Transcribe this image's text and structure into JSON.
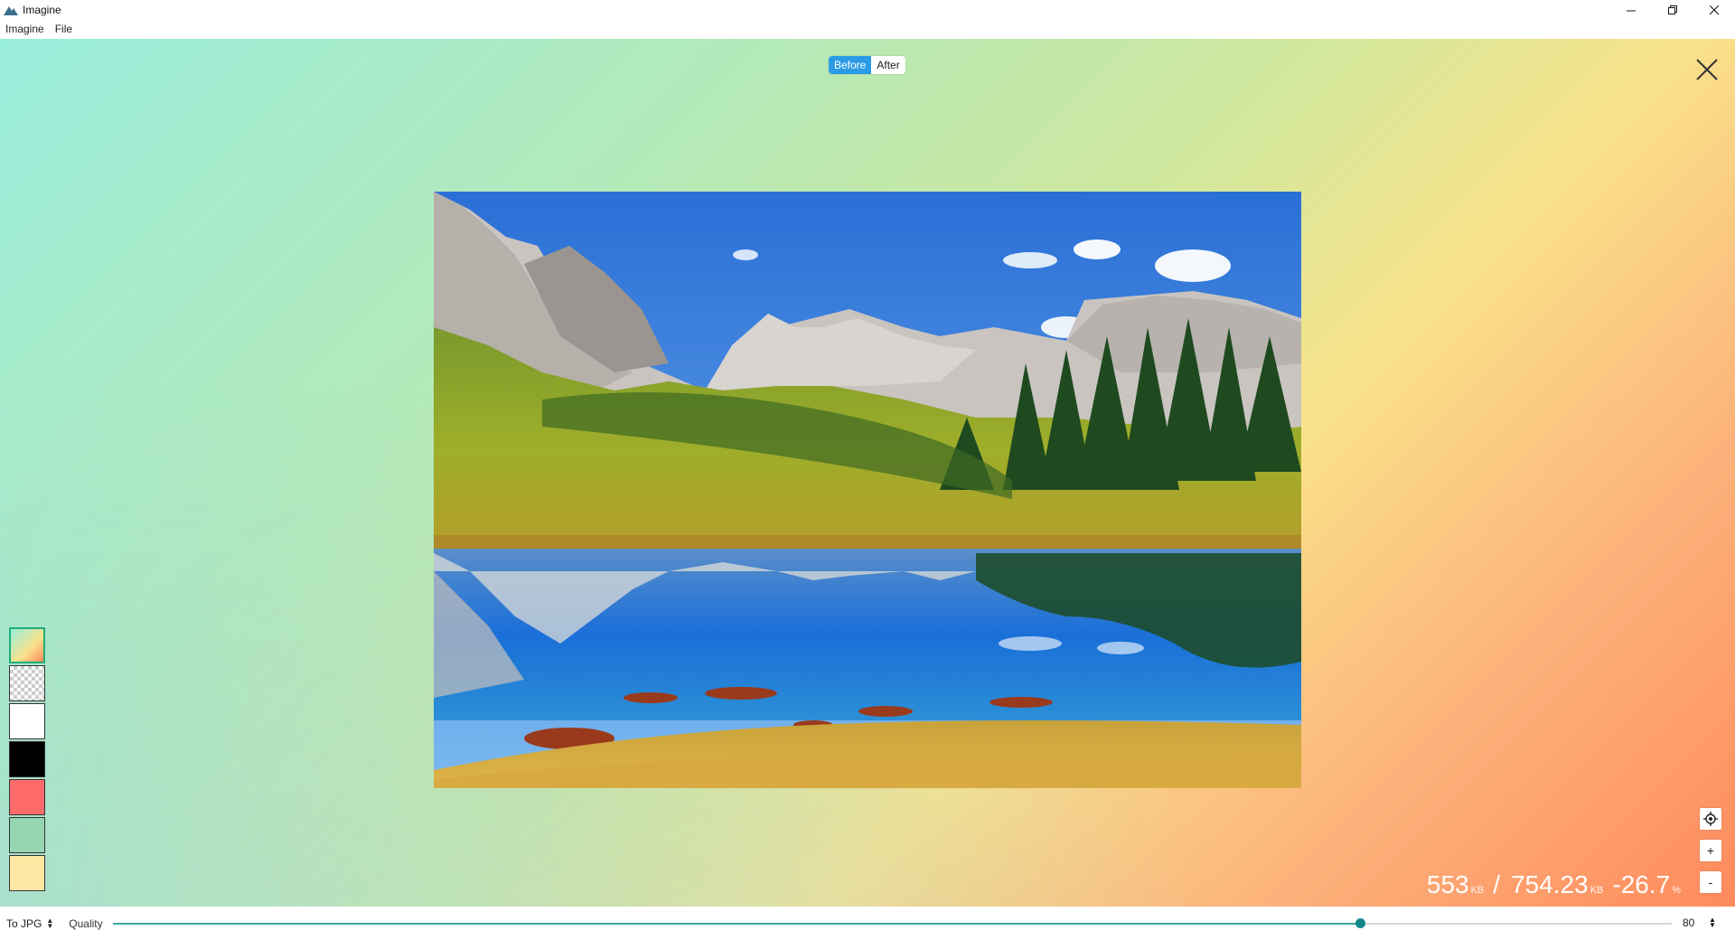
{
  "window": {
    "title": "Imagine",
    "controls": {
      "minimize": "─",
      "maximize": "❐",
      "close": "✕"
    }
  },
  "menu": {
    "items": [
      "Imagine",
      "File"
    ]
  },
  "compare_toggle": {
    "before": "Before",
    "after": "After",
    "active": "Before"
  },
  "icons": {
    "app": "mountain-logo-icon",
    "close": "close-x-icon",
    "locate": "crosshair-icon",
    "zoom_in": "plus-icon",
    "zoom_out": "minus-icon"
  },
  "zoom": {
    "in_label": "+",
    "out_label": "-"
  },
  "background_swatches": [
    {
      "name": "gradient",
      "selected": true
    },
    {
      "name": "transparent-checker",
      "color": "checker"
    },
    {
      "name": "white",
      "color": "#ffffff"
    },
    {
      "name": "black",
      "color": "#000000"
    },
    {
      "name": "red",
      "color": "#ff6b6b"
    },
    {
      "name": "mint",
      "color": "#95d5b2"
    },
    {
      "name": "cream",
      "color": "#ffe8a3"
    }
  ],
  "size": {
    "compressed": "553",
    "compressed_unit": "KB",
    "separator": "/",
    "original": "754.23",
    "original_unit": "KB",
    "change": "-26.7",
    "change_unit": "%"
  },
  "bottom": {
    "format": "To JPG",
    "quality_label": "Quality",
    "quality_value": "80",
    "quality_fraction": 0.8
  },
  "colors": {
    "accent": "#2c9be6",
    "slider": "#14868a"
  }
}
